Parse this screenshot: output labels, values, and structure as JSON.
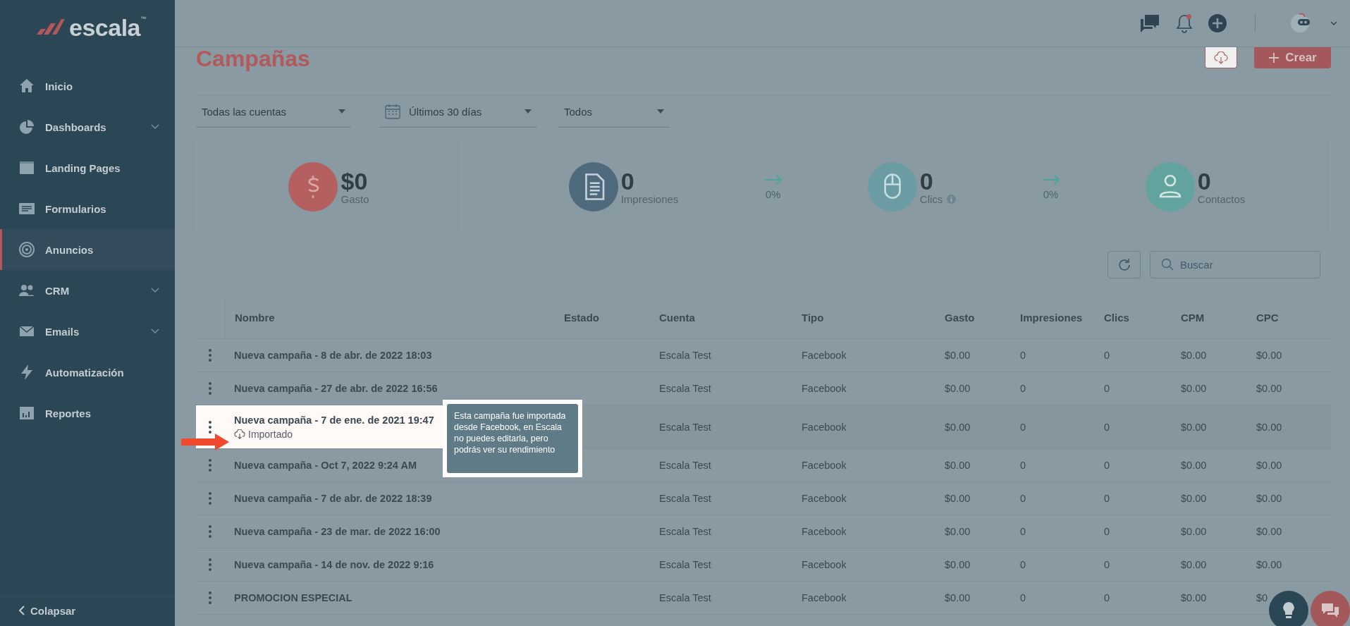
{
  "brand": {
    "name": "escala",
    "mark": "™"
  },
  "sidebar": {
    "items": [
      {
        "label": "Inicio",
        "expandable": false,
        "selected": false
      },
      {
        "label": "Dashboards",
        "expandable": true,
        "selected": false
      },
      {
        "label": "Landing Pages",
        "expandable": false,
        "selected": false
      },
      {
        "label": "Formularios",
        "expandable": false,
        "selected": false
      },
      {
        "label": "Anuncios",
        "expandable": false,
        "selected": true
      },
      {
        "label": "CRM",
        "expandable": true,
        "selected": false
      },
      {
        "label": "Emails",
        "expandable": true,
        "selected": false
      },
      {
        "label": "Automatización",
        "expandable": false,
        "selected": false
      },
      {
        "label": "Reportes",
        "expandable": false,
        "selected": false
      }
    ],
    "collapse": "Colapsar"
  },
  "header": {
    "unread_notifications": true
  },
  "page": {
    "title": "Campañas",
    "create_button": "Crear"
  },
  "filters": [
    {
      "kind": "dropdown",
      "value": "Todas las cuentas"
    },
    {
      "kind": "date",
      "value": "Últimos 30 días"
    },
    {
      "kind": "dropdown",
      "value": "Todos"
    }
  ],
  "metrics": [
    {
      "value": "$0",
      "label": "Gasto",
      "color": "#b45f60",
      "info": false
    },
    {
      "value": "0",
      "label": "Impresiones",
      "color": "#4f6a7d",
      "info": false
    },
    {
      "value": "0",
      "label": "Clics",
      "color": "#6b9ba3",
      "info": true
    },
    {
      "value": "0",
      "label": "Contactos",
      "color": "#62a39d",
      "info": false
    }
  ],
  "rates": [
    "0%",
    "0%"
  ],
  "search": {
    "placeholder": "Buscar"
  },
  "table": {
    "columns": [
      "Nombre",
      "Estado",
      "Cuenta",
      "Tipo",
      "Gasto",
      "Impresiones",
      "Clics",
      "CPM",
      "CPC"
    ],
    "rows": [
      {
        "name": "Nueva campaña - 8 de abr. de 2022 18:03",
        "highlighted": false,
        "account": "Escala Test",
        "type": "Facebook",
        "spend": "$0.00",
        "impressions": "0",
        "clicks": "0",
        "cpm": "$0.00",
        "cpc": "$0.00"
      },
      {
        "name": "Nueva campaña - 27 de abr. de 2022 16:56",
        "highlighted": false,
        "account": "Escala Test",
        "type": "Facebook",
        "spend": "$0.00",
        "impressions": "0",
        "clicks": "0",
        "cpm": "$0.00",
        "cpc": "$0.00"
      },
      {
        "name": "Nueva campaña - 7 de ene. de 2021 19:47",
        "badge": "Importado",
        "highlighted": true,
        "tooltip": "Esta campaña fue importada desde Facebook, en Escala no puedes editarla, pero podrás ver su rendimiento",
        "account": "Escala Test",
        "type": "Facebook",
        "spend": "$0.00",
        "impressions": "0",
        "clicks": "0",
        "cpm": "$0.00",
        "cpc": "$0.00"
      },
      {
        "name": "Nueva campaña - Oct 7, 2022 9:24 AM",
        "highlighted": false,
        "account": "Escala Test",
        "type": "Facebook",
        "spend": "$0.00",
        "impressions": "0",
        "clicks": "0",
        "cpm": "$0.00",
        "cpc": "$0.00"
      },
      {
        "name": "Nueva campaña - 7 de abr. de 2022 18:39",
        "highlighted": false,
        "account": "Escala Test",
        "type": "Facebook",
        "spend": "$0.00",
        "impressions": "0",
        "clicks": "0",
        "cpm": "$0.00",
        "cpc": "$0.00"
      },
      {
        "name": "Nueva campaña - 23 de mar. de 2022 16:00",
        "highlighted": false,
        "account": "Escala Test",
        "type": "Facebook",
        "spend": "$0.00",
        "impressions": "0",
        "clicks": "0",
        "cpm": "$0.00",
        "cpc": "$0.00"
      },
      {
        "name": "Nueva campaña - 14 de nov. de 2022 9:16",
        "highlighted": false,
        "account": "Escala Test",
        "type": "Facebook",
        "spend": "$0.00",
        "impressions": "0",
        "clicks": "0",
        "cpm": "$0.00",
        "cpc": "$0.00"
      },
      {
        "name": "PROMOCION ESPECIAL",
        "highlighted": false,
        "account": "Escala Test",
        "type": "Facebook",
        "spend": "$0.00",
        "impressions": "0",
        "clicks": "0",
        "cpm": "$0.00",
        "cpc": "$0"
      }
    ]
  }
}
